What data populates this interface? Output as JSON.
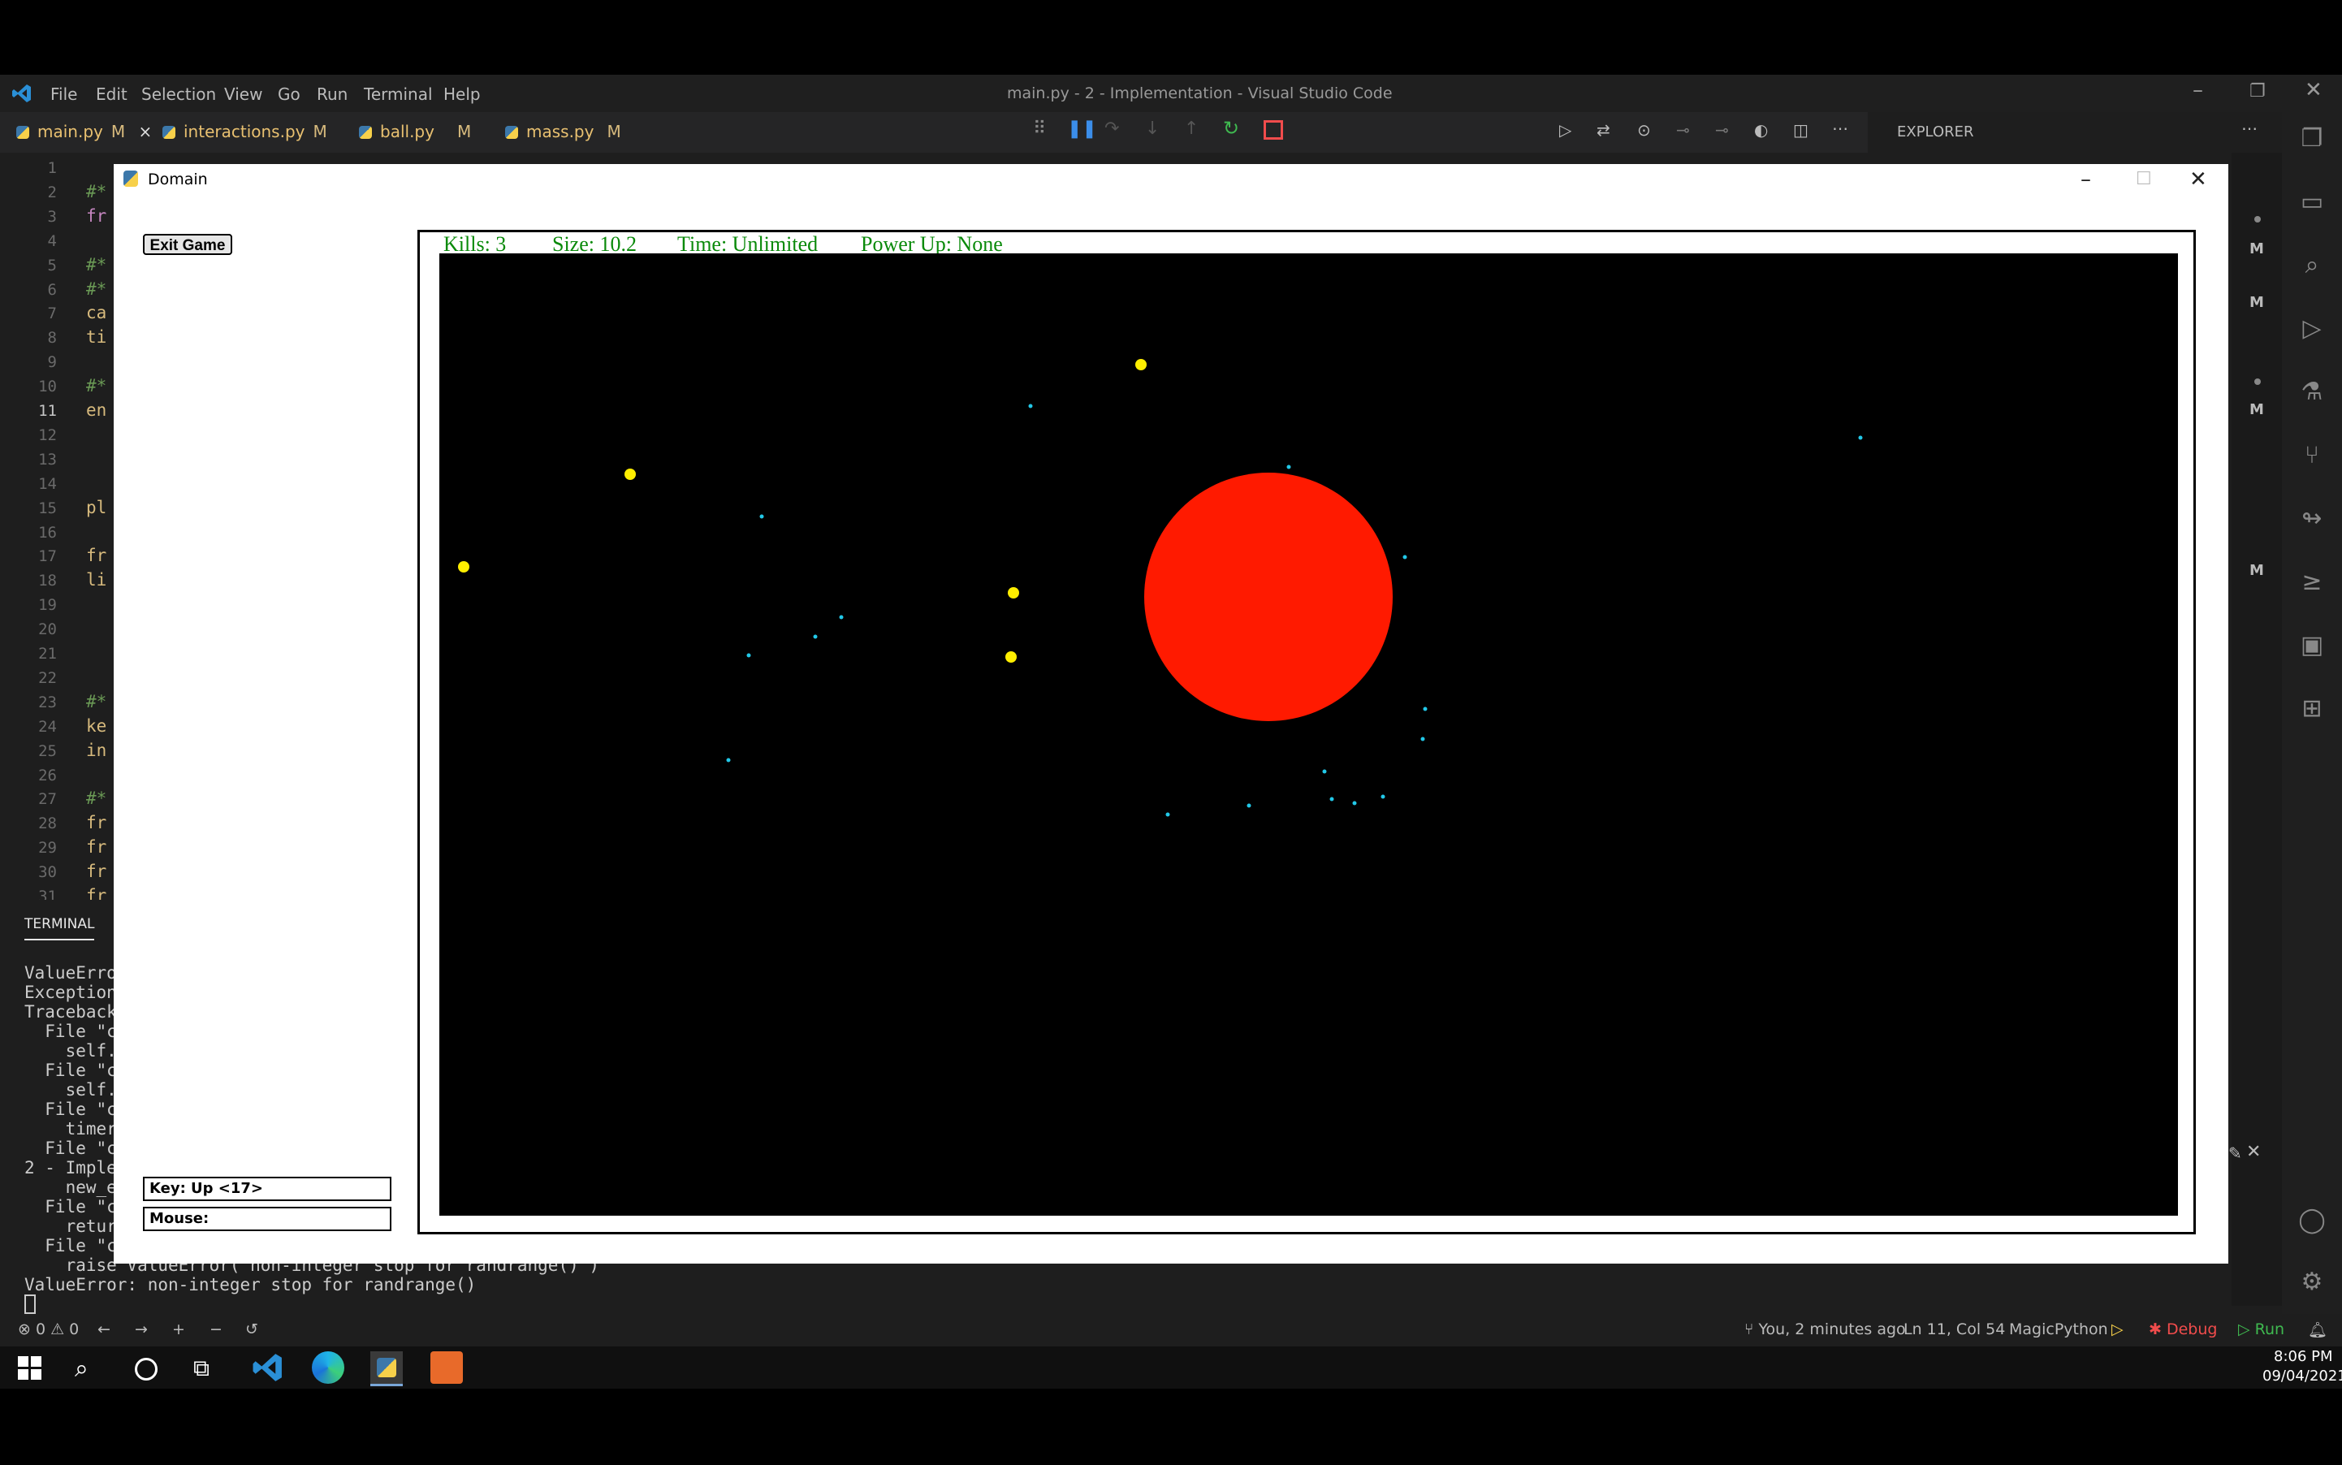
{
  "vscode": {
    "window_title": "main.py - 2 - Implementation - Visual Studio Code",
    "menu": [
      "File",
      "Edit",
      "Selection",
      "View",
      "Go",
      "Run",
      "Terminal",
      "Help"
    ],
    "tabs": [
      {
        "label": "main.py",
        "badge": "M",
        "close": "×"
      },
      {
        "label": "interactions.py",
        "badge": "M"
      },
      {
        "label": "ball.py",
        "badge": "M"
      },
      {
        "label": "mass.py",
        "badge": "M"
      }
    ],
    "explorer_label": "EXPLORER",
    "line_numbers": [
      "1",
      "2",
      "3",
      "4",
      "5",
      "6",
      "7",
      "8",
      "9",
      "10",
      "11",
      "12",
      "13",
      "14",
      "15",
      "16",
      "17",
      "18",
      "19",
      "20",
      "21",
      "22",
      "23",
      "24",
      "25",
      "26",
      "27",
      "28",
      "29",
      "30",
      "31"
    ],
    "code_fragments": [
      {
        "line": "2",
        "text": "#*",
        "color": "#6a9955"
      },
      {
        "line": "3",
        "text": "fr",
        "color": "#c586c0"
      },
      {
        "line": "5",
        "text": "#*",
        "color": "#6a9955"
      },
      {
        "line": "6",
        "text": "#*",
        "color": "#6a9955"
      },
      {
        "line": "7",
        "text": "ca",
        "color": "#d7ba7d"
      },
      {
        "line": "8",
        "text": "ti",
        "color": "#d7ba7d"
      },
      {
        "line": "10",
        "text": "#*",
        "color": "#6a9955"
      },
      {
        "line": "11",
        "text": "en",
        "color": "#d7ba7d"
      },
      {
        "line": "15",
        "text": "pl",
        "color": "#d7ba7d"
      },
      {
        "line": "17",
        "text": "fr",
        "color": "#d7ba7d"
      },
      {
        "line": "18",
        "text": "li",
        "color": "#d7ba7d"
      },
      {
        "line": "23",
        "text": "#*",
        "color": "#6a9955"
      },
      {
        "line": "24",
        "text": "ke",
        "color": "#d7ba7d"
      },
      {
        "line": "25",
        "text": "in",
        "color": "#d7ba7d"
      },
      {
        "line": "27",
        "text": "#*",
        "color": "#6a9955"
      },
      {
        "line": "28",
        "text": "fr",
        "color": "#d7ba7d"
      },
      {
        "line": "29",
        "text": "fr",
        "color": "#d7ba7d"
      },
      {
        "line": "30",
        "text": "fr",
        "color": "#d7ba7d"
      },
      {
        "line": "31",
        "text": "fr",
        "color": "#d7ba7d"
      }
    ],
    "terminal": {
      "tab_label": "TERMINAL",
      "lines": [
        "ValueErro",
        "Exception",
        "Traceback",
        "  File \"c",
        "    self.",
        "  File \"c",
        "    self.",
        "  File \"c",
        "    timer",
        "  File \"c",
        "2 - Imple",
        "    new_e",
        "  File \"c",
        "    retur",
        "  File \"c",
        "    raise ValueError(\"non-integer stop for randrange()\")",
        "ValueError: non-integer stop for randrange()"
      ]
    },
    "statusbar": {
      "problems": "⊗ 0 ⚠ 0",
      "git": "You, 2 minutes ago",
      "position": "Ln 11, Col 54",
      "language": "MagicPython",
      "debug": "Debug",
      "run": "Run"
    }
  },
  "taskbar": {
    "time": "8:06 PM",
    "date": "09/04/2021"
  },
  "domain_window": {
    "title": "Domain",
    "exit_button": "Exit Game",
    "key_label": "Key: Up <17>",
    "mouse_label": "Mouse:",
    "hud": {
      "kills": "Kills: 3",
      "size": "Size: 10.2",
      "time": "Time: Unlimited",
      "power_up": "Power Up: None"
    },
    "colors": {
      "player": "#ff1a00",
      "food": "#ffee00",
      "particles": "#22c8e8",
      "hud_text": "#0a8a0a"
    }
  }
}
